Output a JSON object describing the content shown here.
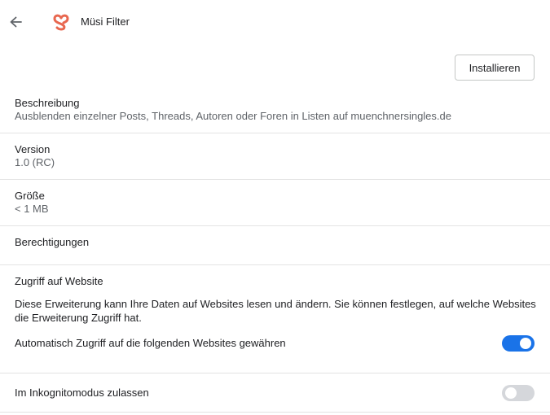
{
  "header": {
    "back_icon": "arrow-left-icon",
    "extension_name": "Müsi Filter",
    "logo_icon": "extension-logo-icon",
    "logo_color": "#e8674f"
  },
  "install_label": "Installieren",
  "description": {
    "label": "Beschreibung",
    "value": "Ausblenden einzelner Posts, Threads, Autoren oder Foren in Listen auf muenchnersingles.de"
  },
  "version": {
    "label": "Version",
    "value": "1.0 (RC)"
  },
  "size": {
    "label": "Größe",
    "value": "< 1 MB"
  },
  "permissions": {
    "label": "Berechtigungen"
  },
  "site_access": {
    "heading": "Zugriff auf Website",
    "text": "Diese Erweiterung kann Ihre Daten auf Websites lesen und ändern. Sie können festlegen, auf welche Websites die Erweiterung Zugriff hat.",
    "auto_access_label": "Automatisch Zugriff auf die folgenden Websites gewähren",
    "auto_access_on": true
  },
  "incognito": {
    "label": "Im Inkognitomodus zulassen",
    "enabled": false
  },
  "colors": {
    "accent": "#1a73e8",
    "toggle_off": "#d5d7db"
  }
}
